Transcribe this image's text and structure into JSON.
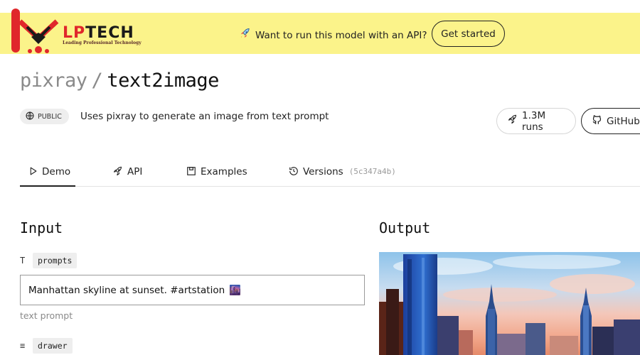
{
  "banner": {
    "logo_text_lp": "LP",
    "logo_text_tech": "TECH",
    "logo_tagline": "Leading Professional Technology",
    "message": "Want to run this model with an API?",
    "message_icon": "rocket-icon",
    "cta_label": "Get started",
    "background": "#fbf38a",
    "logo_red": "#e0272b"
  },
  "header": {
    "owner": "pixray",
    "separator": "/",
    "model": "text2image",
    "visibility": "PUBLIC",
    "description": "Uses pixray to generate an image from text prompt",
    "runs_label": "1.3M runs",
    "github_label": "GitHub"
  },
  "tabs": [
    {
      "label": "Demo",
      "icon": "play-icon",
      "active": true
    },
    {
      "label": "API",
      "icon": "rocket-icon"
    },
    {
      "label": "Examples",
      "icon": "image-icon"
    },
    {
      "label": "Versions",
      "icon": "history-icon",
      "hash": "(5c347a4b)"
    }
  ],
  "input": {
    "heading": "Input",
    "fields": [
      {
        "type_glyph": "T",
        "name": "prompts",
        "value": "Manhattan skyline at sunset. #artstation",
        "value_emoji": "🌆",
        "hint": "text prompt"
      },
      {
        "type_glyph": "≡",
        "name": "drawer"
      }
    ]
  },
  "output": {
    "heading": "Output"
  }
}
